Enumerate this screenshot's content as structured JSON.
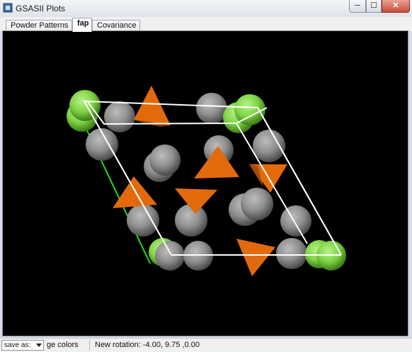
{
  "window": {
    "title": "GSASII Plots",
    "icon": "gsas-app-icon"
  },
  "window_controls": {
    "minimize": "─",
    "maximize": "☐",
    "close": "✕"
  },
  "tabs": [
    {
      "label": "Powder Patterns",
      "active": false
    },
    {
      "label": "fap",
      "active": true
    },
    {
      "label": "Covariance",
      "active": false
    }
  ],
  "plot": {
    "background": "#000000",
    "colors": {
      "unit_cell": "#ffffff",
      "sphere_grey": "#8a8a8a",
      "sphere_green": "#7ed444",
      "polyhedra": "#e36a0c",
      "axis_a": "#ff2020",
      "axis_b": "#22dd22"
    }
  },
  "statusbar": {
    "save_as": "save as:",
    "left_text": "ge colors",
    "rotation_text": "New rotation: -4.00, 9.75 ,0.00"
  }
}
